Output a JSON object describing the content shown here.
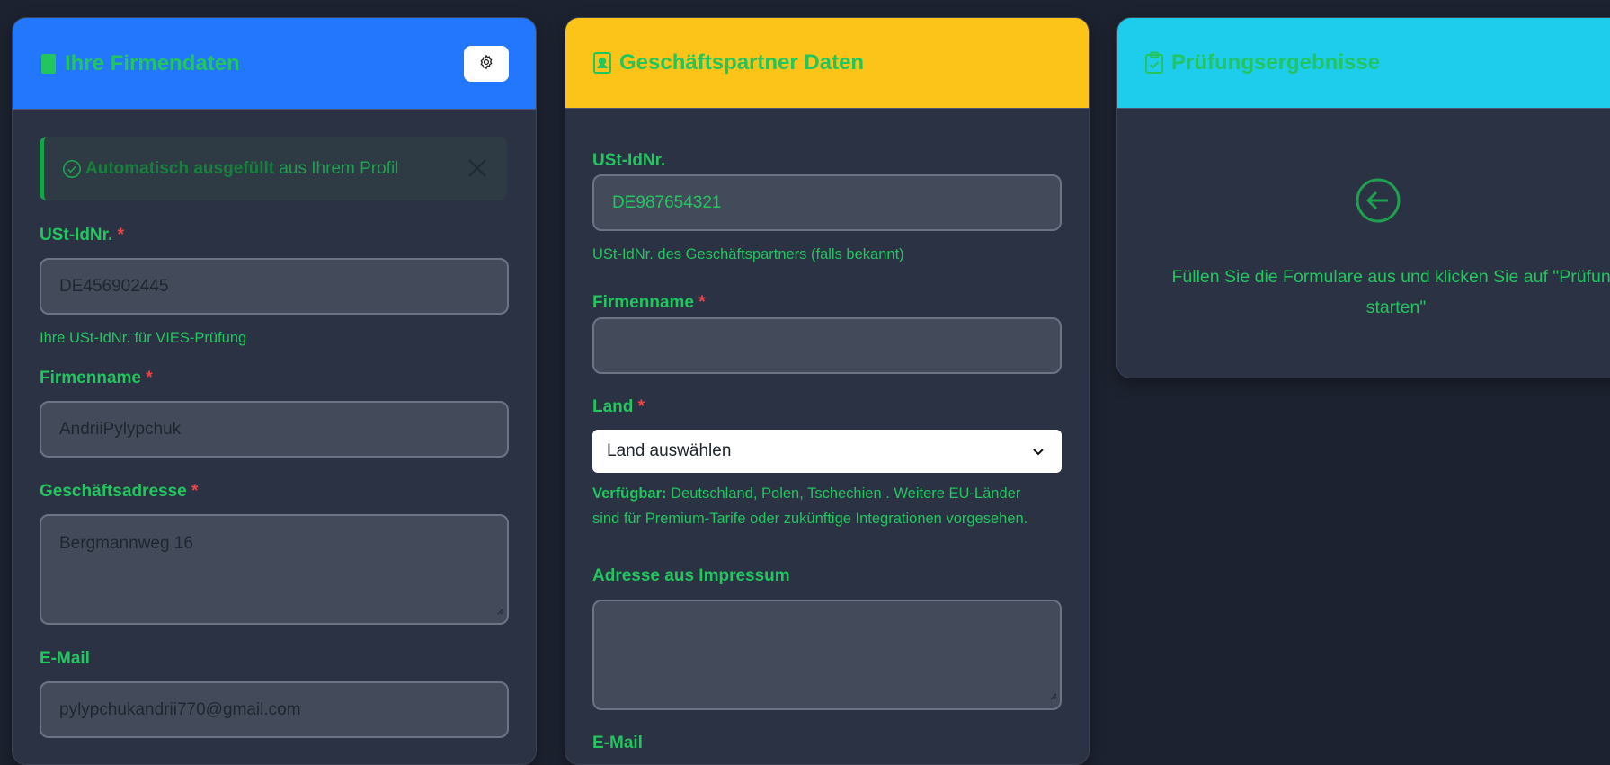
{
  "company": {
    "title": "Ihre Firmendaten",
    "alert": {
      "bold": "Automatisch ausgefüllt",
      "rest": "aus Ihrem Profil"
    },
    "vat": {
      "label": "USt-IdNr.",
      "value": "DE456902445",
      "help": "Ihre USt-IdNr. für VIES-Prüfung"
    },
    "name": {
      "label": "Firmenname",
      "value": "AndriiPylypchuk"
    },
    "address": {
      "label": "Geschäftsadresse",
      "value": "Bergmannweg 16"
    },
    "email": {
      "label": "E-Mail",
      "value": "pylypchukandrii770@gmail.com"
    },
    "required_mark": "*"
  },
  "partner": {
    "title": "Geschäftspartner Daten",
    "vat": {
      "label": "USt-IdNr.",
      "placeholder": "DE987654321",
      "help": "USt-IdNr. des Geschäftspartners (falls bekannt)"
    },
    "name": {
      "label": "Firmenname",
      "value": ""
    },
    "country": {
      "label": "Land",
      "selected": "Land auswählen",
      "help_bold": "Verfügbar:",
      "help_line1": " Deutschland, Polen, Tschechien . Weitere EU-Länder",
      "help_line2": "sind für Premium-Tarife oder zukünftige Integrationen vorgesehen."
    },
    "address": {
      "label": "Adresse aus Impressum",
      "value": ""
    },
    "email": {
      "label": "E-Mail"
    },
    "required_mark": "*"
  },
  "results": {
    "title": "Prüfungsergebnisse",
    "empty_line1": "Füllen Sie die Formulare aus und klicken Sie auf \"Prüfung",
    "empty_line2": "starten\""
  },
  "colors": {
    "company_header": "#2277fc",
    "partner_header": "#fcc419",
    "results_header": "#1ecdec",
    "accent_green": "#22c55e",
    "required_red": "#ef4444"
  },
  "icons": {
    "company": "building-icon",
    "partner": "person-badge-icon",
    "results": "clipboard-check-icon",
    "settings": "gear-icon",
    "alert": "check-circle-icon",
    "close": "close-icon",
    "select": "chevron-down-icon",
    "empty": "arrow-left-circle-icon"
  }
}
